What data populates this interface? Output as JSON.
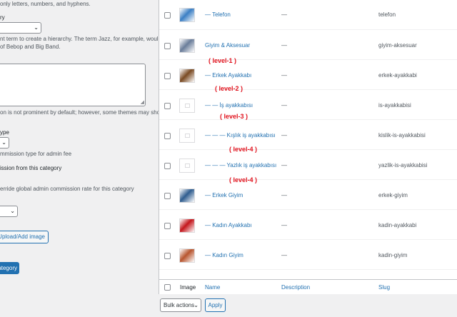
{
  "form": {
    "slug_help": "only letters, numbers, and hyphens.",
    "parent_label": "ry",
    "parent_help_1": "nt term to create a hierarchy. The term Jazz, for example, would",
    "parent_help_2": "of Bebop and Big Band.",
    "description_help": "on is not prominent by default; however, some themes may show",
    "commission_type_label": "ype",
    "commission_type_help": "mmission type for admin fee",
    "commission_checkbox_label": "ission from this category",
    "commission_rate_help": "erride global admin commission rate for this category",
    "upload_button": "Upload/Add image",
    "add_button": "ategory"
  },
  "table": {
    "rows": [
      {
        "name": "— Telefon",
        "description": "—",
        "slug": "telefon",
        "thumb": "phone",
        "thumb_color": "#3b7fc4"
      },
      {
        "name": "Giyim & Aksesuar",
        "description": "—",
        "slug": "giyim-aksesuar",
        "thumb": "clothes",
        "thumb_color": "#6a7d9a"
      },
      {
        "name": "— Erkek Ayakkabı",
        "description": "—",
        "slug": "erkek-ayakkabi",
        "thumb": "shoe",
        "thumb_color": "#7a4a22"
      },
      {
        "name": "— — İş ayakkabısı",
        "description": "—",
        "slug": "is-ayakkabisi",
        "thumb": "placeholder"
      },
      {
        "name": "— — — Kışlık iş ayakkabısı",
        "description": "—",
        "slug": "kislik-is-ayakkabisi",
        "thumb": "placeholder"
      },
      {
        "name": "— — — Yazlık iş ayakkabısı",
        "description": "—",
        "slug": "yazlik-is-ayakkabisi",
        "thumb": "placeholder"
      },
      {
        "name": "— Erkek Giyim",
        "description": "—",
        "slug": "erkek-giyim",
        "thumb": "shirt",
        "thumb_color": "#2f5d8f"
      },
      {
        "name": "— Kadın Ayakkabı",
        "description": "—",
        "slug": "kadin-ayakkabi",
        "thumb": "heels",
        "thumb_color": "#c4161c"
      },
      {
        "name": "— Kadın Giyim",
        "description": "—",
        "slug": "kadin-giyim",
        "thumb": "rack",
        "thumb_color": "#b8552e"
      }
    ],
    "annotations": [
      "( level-1 )",
      "( level-2 )",
      "( level-3 )",
      "( level-4 )",
      "( level-4 )"
    ],
    "footer": {
      "image": "Image",
      "name": "Name",
      "description": "Description",
      "slug": "Slug"
    }
  },
  "bulk": {
    "select": "Bulk actions",
    "apply": "Apply"
  },
  "colors": {
    "link": "#2271b1",
    "annotation": "#e0101b",
    "primary": "#2271b1"
  }
}
